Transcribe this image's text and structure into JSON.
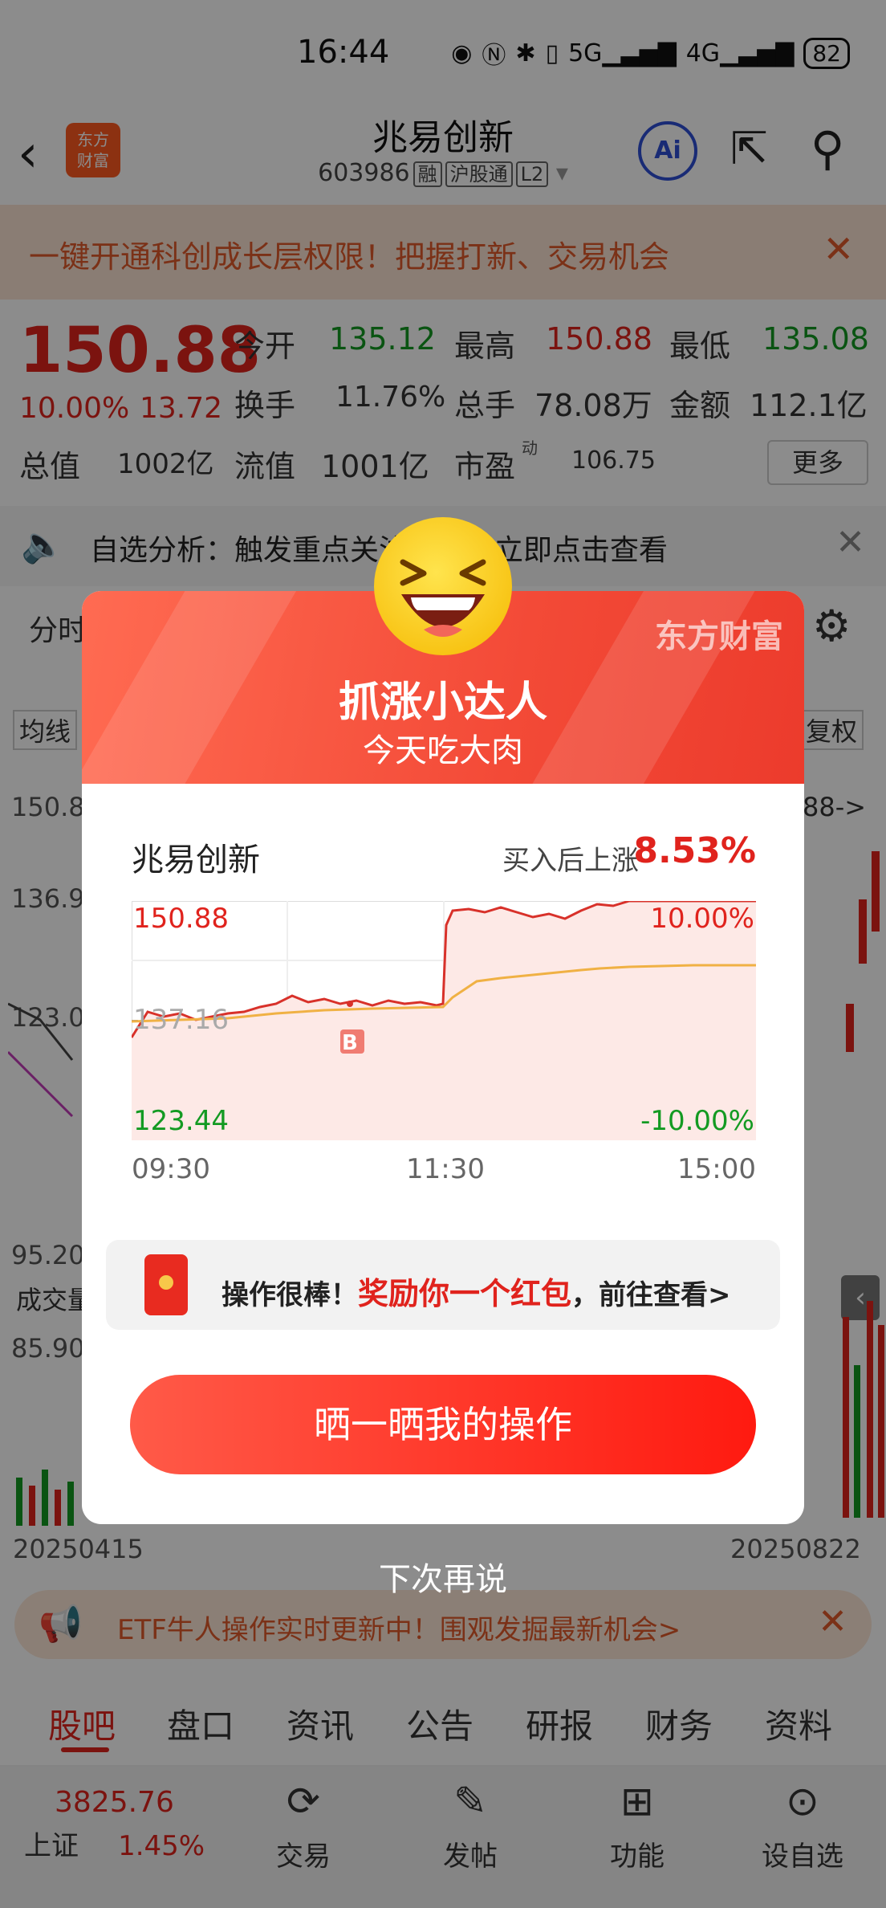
{
  "status": {
    "time": "16:44",
    "battery": "82",
    "net1": "5G",
    "net2": "4G"
  },
  "header": {
    "logo": "东方\n财富",
    "title": "兆易创新",
    "code": "603986",
    "tags": [
      "融",
      "沪股通",
      "L2"
    ],
    "ai": "Ai"
  },
  "banner": {
    "text": "一键开通科创成长层权限！把握打新、交易机会"
  },
  "quote": {
    "price": "150.88",
    "pct": "10.00%",
    "change": "13.72",
    "open_l": "今开",
    "open": "135.12",
    "high_l": "最高",
    "high": "150.88",
    "low_l": "最低",
    "low": "135.08",
    "turnover_l": "换手",
    "turnover": "11.76%",
    "volume_l": "总手",
    "volume": "78.08万",
    "amount_l": "金额",
    "amount": "112.1亿",
    "mcap_l": "总值",
    "mcap": "1002亿",
    "float_l": "流值",
    "float": "1001亿",
    "pe_l": "市盈",
    "pe_sup": "动",
    "pe": "106.75",
    "more": "更多"
  },
  "analysis": {
    "text": "自选分析：触发重点关注信号，立即点击查看"
  },
  "bg_chart": {
    "tab": "分时",
    "ma": "均线",
    "fq": "复权",
    "y1": "150.8",
    "y2": "136.9",
    "y3": "123.0",
    "y4": "95.20",
    "vol_label": "成交量",
    "vol_y": "85.90",
    "right_tag": "88->",
    "date_start": "20250415",
    "date_end": "20250822"
  },
  "modal": {
    "brand": "东方财富",
    "title": "抓涨小达人",
    "subtitle": "今天吃大肉",
    "stock_name": "兆易创新",
    "rise_label": "买入后上涨",
    "rise_value": "8.53%",
    "chart": {
      "y_top": "150.88",
      "y_mid": "137.16",
      "y_bottom": "123.44",
      "pct_top": "10.00%",
      "pct_bottom": "-10.00%",
      "x_labels": [
        "09:30",
        "11:30",
        "15:00"
      ],
      "buy_marker": "B"
    },
    "reward_prefix": "操作很棒！",
    "reward_highlight": "奖励你一个红包",
    "reward_suffix": "，前往查看>",
    "share_button": "晒一晒我的操作",
    "later": "下次再说"
  },
  "etf_banner": {
    "text": "ETF牛人操作实时更新中！围观发掘最新机会>"
  },
  "tabs": [
    "股吧",
    "盘口",
    "资讯",
    "公告",
    "研报",
    "财务",
    "资料"
  ],
  "nav": {
    "index_value": "3825.76",
    "index_name": "上证",
    "index_pct": "1.45%",
    "items": [
      {
        "label": "交易",
        "icon": "yen-icon"
      },
      {
        "label": "发帖",
        "icon": "edit-icon"
      },
      {
        "label": "功能",
        "icon": "grid-icon"
      },
      {
        "label": "设自选",
        "icon": "more-icon"
      }
    ]
  },
  "colors": {
    "up": "#e0231d",
    "down": "#139a22",
    "accent": "#ff5a1f"
  }
}
